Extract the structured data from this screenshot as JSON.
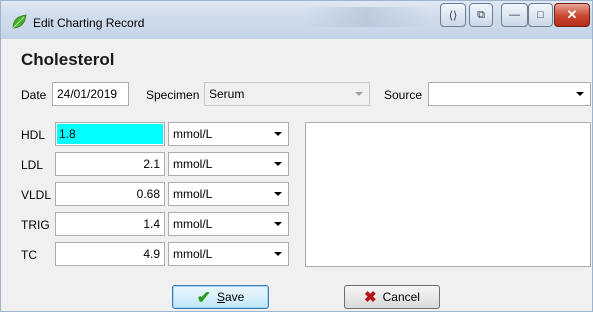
{
  "window": {
    "title": "Edit Charting Record"
  },
  "titlebar_buttons": [
    {
      "name": "code-icon",
      "glyph": "⟨⟩"
    },
    {
      "name": "copy-icon",
      "glyph": "⧉"
    },
    {
      "name": "minimize",
      "glyph": "—"
    },
    {
      "name": "maximize",
      "glyph": "□"
    },
    {
      "name": "close",
      "glyph": "✕"
    }
  ],
  "heading": "Cholesterol",
  "date": {
    "label": "Date",
    "value": "24/01/2019"
  },
  "specimen": {
    "label": "Specimen",
    "value": "Serum"
  },
  "source": {
    "label": "Source",
    "value": ""
  },
  "measurements": [
    {
      "label": "HDL",
      "value": "1.8",
      "unit": "mmol/L",
      "selected": true
    },
    {
      "label": "LDL",
      "value": "2.1",
      "unit": "mmol/L"
    },
    {
      "label": "VLDL",
      "value": "0.68",
      "unit": "mmol/L"
    },
    {
      "label": "TRIG",
      "value": "1.4",
      "unit": "mmol/L"
    },
    {
      "label": "TC",
      "value": "4.9",
      "unit": "mmol/L"
    }
  ],
  "notes": "",
  "buttons": {
    "save": {
      "mnemonic": "S",
      "rest": "ave",
      "icon": "check-icon"
    },
    "cancel": {
      "label": "Cancel",
      "icon": "x-icon"
    }
  },
  "colors": {
    "selection": "#00ffff",
    "save_icon": "#2f9d1f",
    "cancel_icon": "#b5121b"
  }
}
